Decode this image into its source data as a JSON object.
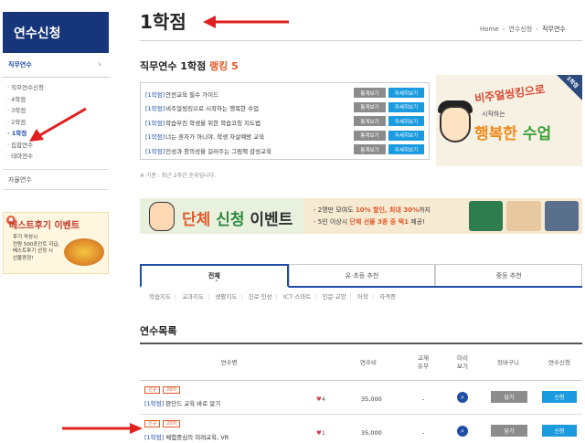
{
  "sidebar": {
    "title": "연수신청",
    "category": "직무연수",
    "items": [
      "· 직무연수신청",
      "· 4학점",
      "· 3학점",
      "· 2학점",
      "· 1학점",
      "· 집합연수",
      "· 테마연수"
    ],
    "active_index": 4,
    "other": "자율연수",
    "banner": {
      "title": "베스트후기 이벤트",
      "lines": [
        "후기 작성시",
        "전원 500포인트 지급,",
        "베스트후기 선정 시",
        "선물증정!"
      ]
    }
  },
  "header": {
    "page_title": "1학점",
    "breadcrumb": [
      "Home",
      "연수신청",
      "직무연수"
    ]
  },
  "ranking": {
    "title_prefix": "직무연수 1학점",
    "title_highlight": "랭킹 5",
    "rows": [
      {
        "tag": "[1학점]",
        "text": "안전교육 필수 가이드"
      },
      {
        "tag": "[1학점]",
        "text": "비주얼씽킹으로 시작하는 행복한 수업"
      },
      {
        "tag": "[1학점]",
        "text": "학습부진 학생을 위한 학습코칭 지도법"
      },
      {
        "tag": "[1학점]",
        "text": "너는 혼자가 아니야, 학생 자살예방 교육"
      },
      {
        "tag": "[1학점]",
        "text": "인성과 창의성을 길러주는 그림책 감성교육"
      }
    ],
    "btn_stats": "통계보기",
    "btn_detail": "자세히보기",
    "note": "※ 기준 : 최근 2주간 순위입니다."
  },
  "right_banner": {
    "corner": "1학점",
    "line1": "비주얼씽킹으로",
    "line2": "시작하는",
    "line3a": "행복한 ",
    "line3b": "수업"
  },
  "event_banner": {
    "t1": "단체",
    "t2": "신청",
    "t3": "이벤트",
    "desc1a": "- 2명만 모여도 ",
    "desc1b": "10% 할인, 최대 30%",
    "desc1c": "까지",
    "desc2a": "- 5인 이상시 ",
    "desc2b": "단체 선물 3종 중 택1",
    "desc2c": "제공!"
  },
  "tabs": [
    {
      "label": "전체",
      "active": true
    },
    {
      "label": "유·초등 추천",
      "active": false
    },
    {
      "label": "중등 추천",
      "active": false
    }
  ],
  "subcategories": [
    "학습지도",
    "교과지도",
    "생활지도",
    "진로·인성",
    "ICT·스마트",
    "인문·교양",
    "어학",
    "자격증"
  ],
  "course_list": {
    "title": "연수목록",
    "columns": [
      "연수명",
      "연수비",
      "교재\n유무",
      "미리\n보기",
      "장바구니",
      "연수신청"
    ],
    "rows": [
      {
        "badges": [
          "신규",
          "20차"
        ],
        "tag": "[1학점]",
        "name": "판단드 교육 바로 알기",
        "likes": "4",
        "fee": "35,000",
        "textbook": "-",
        "cart": "담기",
        "apply": "신청"
      },
      {
        "badges": [
          "신규",
          "20차"
        ],
        "tag": "[1학점]",
        "name": "체험중심의 미래교육, VR",
        "likes": "1",
        "fee": "35,000",
        "textbook": "-",
        "cart": "담기",
        "apply": "신청"
      }
    ]
  },
  "colors": {
    "navy": "#17357a",
    "blue_button": "#1a9be0",
    "accent_orange": "#e05a2b",
    "annotation_red": "#e02020"
  }
}
